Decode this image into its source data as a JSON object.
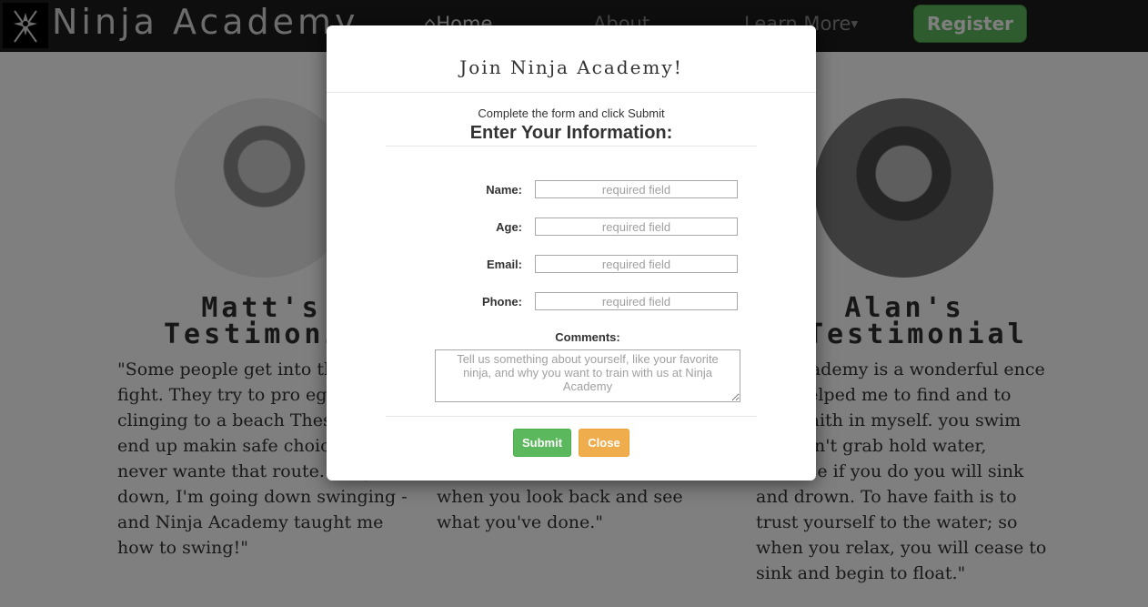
{
  "navbar": {
    "brand": "Ninja Academy",
    "links": [
      "Home",
      "About",
      "Learn More"
    ],
    "register_label": "Register"
  },
  "testimonials": [
    {
      "heading": "Matt's Testimonial",
      "quote": "\"Some people get into this lose a fight. They try to pro ego like clinging to a beach These actors end up makin safe choices. I never wante that route. If I go down, I'm going down swinging - and Ninja Academy taught me how to swing!\""
    },
    {
      "heading": "",
      "quote": "when you look back and see what you've done.\""
    },
    {
      "heading": "Alan's Testimonial",
      "quote": "nja Academy is a wonderful ence that helped me to find and to have faith in myself. you swim you don't grab hold water, because if you do you will sink and drown. To have faith is to trust yourself to the water; so when you relax, you will cease to sink and begin to float.\""
    }
  ],
  "modal": {
    "title": "Join Ninja Academy!",
    "instructions": "Complete the form and click Submit",
    "form_heading": "Enter Your Information:",
    "fields": [
      {
        "label": "Name:",
        "placeholder": "required field",
        "value": ""
      },
      {
        "label": "Age:",
        "placeholder": "required field",
        "value": ""
      },
      {
        "label": "Email:",
        "placeholder": "required field",
        "value": ""
      },
      {
        "label": "Phone:",
        "placeholder": "required field",
        "value": ""
      }
    ],
    "comments_label": "Comments:",
    "comments_placeholder": "Tell us something about yourself, like your favorite ninja, and why you want to train with us at Ninja Academy",
    "submit_label": "Submit",
    "close_label": "Close"
  },
  "colors": {
    "navbar_bg": "#1c1c1c",
    "success": "#5cb85c",
    "warning": "#f0ad4e"
  },
  "icons": [
    "ninja-star-logo-icon",
    "home-icon",
    "caret-down-icon"
  ]
}
